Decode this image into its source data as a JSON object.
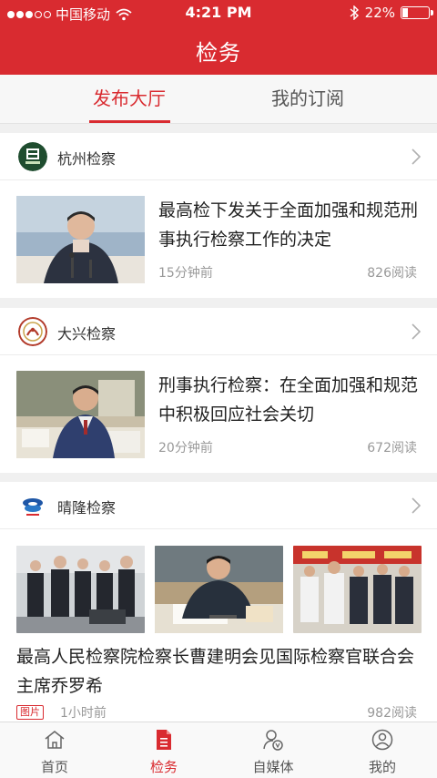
{
  "status_bar": {
    "carrier": "中国移动",
    "time": "4:21 PM",
    "battery": "22%",
    "battery_level": 0.22
  },
  "header": {
    "title": "检务"
  },
  "tabs": [
    {
      "label": "发布大厅",
      "active": true
    },
    {
      "label": "我的订阅",
      "active": false
    }
  ],
  "feed": [
    {
      "source": "杭州检察",
      "headline": "最高检下发关于全面加强和规范刑事执行检察工作的决定",
      "time": "15分钟前",
      "reads": "826阅读"
    },
    {
      "source": "大兴检察",
      "headline": "刑事执行检察：在全面加强和规范中积极回应社会关切",
      "time": "20分钟前",
      "reads": "672阅读"
    },
    {
      "source": "晴隆检察",
      "headline": "最高人民检察院检察长曹建明会见国际检察官联合会主席乔罗希",
      "tag": "图片",
      "time": "1小时前",
      "reads": "982阅读"
    }
  ],
  "tabbar": [
    {
      "label": "首页",
      "icon": "home-icon",
      "active": false
    },
    {
      "label": "检务",
      "icon": "document-icon",
      "active": true
    },
    {
      "label": "自媒体",
      "icon": "person-media-icon",
      "active": false
    },
    {
      "label": "我的",
      "icon": "user-circle-icon",
      "active": false
    }
  ],
  "colors": {
    "accent": "#d92b30",
    "background": "#f0f0f0"
  }
}
